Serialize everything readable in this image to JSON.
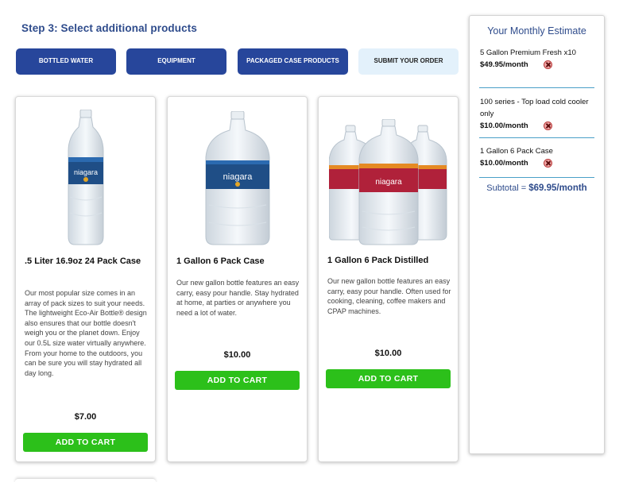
{
  "step_title": "Step 3: Select additional products",
  "categories": [
    {
      "label": "BOTTLED WATER",
      "active": false
    },
    {
      "label": "EQUIPMENT",
      "active": false
    },
    {
      "label": "PACKAGED CASE PRODUCTS",
      "active": false
    },
    {
      "label": "SUBMIT YOUR ORDER",
      "active": true
    }
  ],
  "products": [
    {
      "name": ".5 Liter 16.9oz 24 Pack Case",
      "description": "Our most popular size comes in an array of pack sizes to suit your needs. The lightweight Eco-Air Bottle® design also ensures that our bottle doesn't weigh you or the planet down. Enjoy our 0.5L size water virtually anywhere. From your home to the outdoors, you can be sure you will stay hydrated all day long.",
      "price": "$7.00",
      "button": "ADD TO CART",
      "image_label": "niagara"
    },
    {
      "name": "1 Gallon 6 Pack Case",
      "description": "Our new gallon bottle features an easy carry, easy pour handle. Stay hydrated at home, at parties or anywhere you need a lot of water.",
      "price": "$10.00",
      "button": "ADD TO CART",
      "image_label": "niagara"
    },
    {
      "name": "1 Gallon 6 Pack Distilled",
      "description": "Our new gallon bottle features an easy carry, easy pour handle. Often used for cooking, cleaning, coffee makers and CPAP machines.",
      "price": "$10.00",
      "button": "ADD TO CART",
      "image_label": "niagara"
    }
  ],
  "estimate": {
    "title": "Your Monthly Estimate",
    "items": [
      {
        "name": "5 Gallon Premium Fresh x10",
        "price": "$49.95/month"
      },
      {
        "name": "100 series - Top load cold cooler only",
        "price": "$10.00/month"
      },
      {
        "name": "1 Gallon 6 Pack Case",
        "price": "$10.00/month"
      }
    ],
    "subtotal_label": "Subtotal =",
    "subtotal_value": "$69.95/month"
  },
  "colors": {
    "primary": "#27469b",
    "heading": "#2f4c8c",
    "cart_green": "#2cc01a",
    "active_tab": "#e3f1fb",
    "divider": "#4aa0c8",
    "label_blue": "#1e5fa0",
    "label_red": "#b0213a"
  },
  "icons": {
    "remove": "remove-x-icon"
  }
}
